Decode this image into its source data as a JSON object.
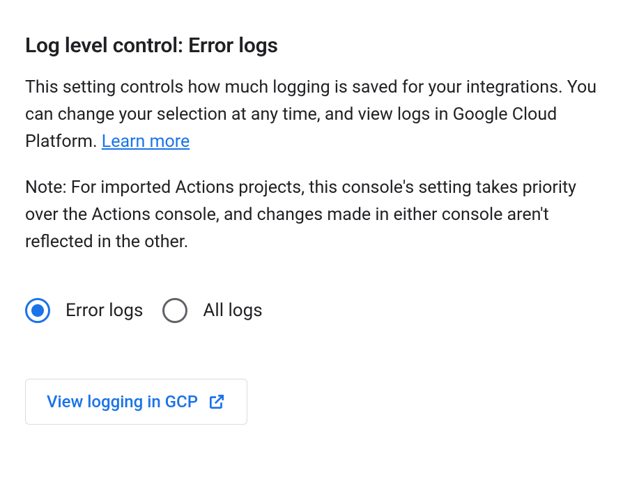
{
  "heading": "Log level control: Error logs",
  "description_part1": "This setting controls how much logging is saved for your integrations. You can change your selection at any time, and view logs in Google Cloud Platform. ",
  "learn_more": "Learn more",
  "note": "Note: For imported Actions projects, this console's setting takes priority over the Actions console, and changes made in either console aren't reflected in the other.",
  "radio_options": {
    "error_logs": "Error logs",
    "all_logs": "All logs"
  },
  "view_button": "View logging in GCP"
}
